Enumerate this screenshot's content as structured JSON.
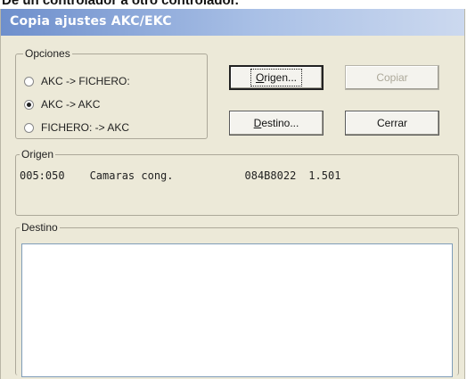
{
  "page_caption": "De un controlador a otro controlador.",
  "window": {
    "title": "Copia ajustes AKC/EKC"
  },
  "options": {
    "legend": "Opciones",
    "items": [
      {
        "label": "AKC  -> FICHERO:",
        "checked": false
      },
      {
        "label": "AKC  -> AKC",
        "checked": true
      },
      {
        "label": "FICHERO: -> AKC",
        "checked": false
      }
    ]
  },
  "buttons": {
    "origin": {
      "accel": "O",
      "rest": "rigen..."
    },
    "copy": "Copiar",
    "destination": {
      "accel": "D",
      "rest": "estino..."
    },
    "close": "Cerrar"
  },
  "origin": {
    "legend": "Origen",
    "row": {
      "address": "005:050",
      "name": "Camaras cong.",
      "code": "084B8022",
      "version": "1.501"
    }
  },
  "destination": {
    "legend": "Destino"
  },
  "colors": {
    "dialog_bg": "#ece9d8",
    "title_gradient_start": "#6e8fcc",
    "title_gradient_end": "#ccd9ef",
    "field_border": "#7f9db9"
  }
}
